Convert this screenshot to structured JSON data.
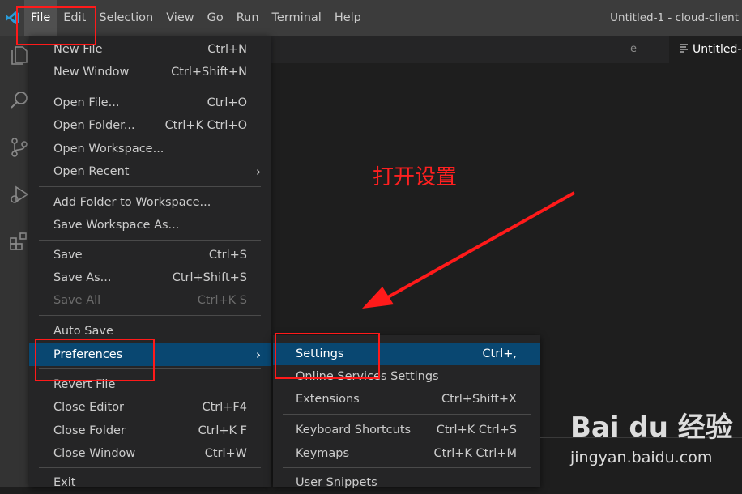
{
  "app": {
    "window_title": "Untitled-1 - cloud-client"
  },
  "menubar": {
    "items": [
      "File",
      "Edit",
      "Selection",
      "View",
      "Go",
      "Run",
      "Terminal",
      "Help"
    ]
  },
  "editor": {
    "active_tab": "Untitled-1",
    "ghost_tab_fragment": "e"
  },
  "file_menu": {
    "items": [
      {
        "label": "New File",
        "shortcut": "Ctrl+N"
      },
      {
        "label": "New Window",
        "shortcut": "Ctrl+Shift+N"
      },
      {
        "label": "Open File...",
        "shortcut": "Ctrl+O"
      },
      {
        "label": "Open Folder...",
        "shortcut": "Ctrl+K Ctrl+O"
      },
      {
        "label": "Open Workspace...",
        "shortcut": ""
      },
      {
        "label": "Open Recent",
        "shortcut": ""
      },
      {
        "label": "Add Folder to Workspace...",
        "shortcut": ""
      },
      {
        "label": "Save Workspace As...",
        "shortcut": ""
      },
      {
        "label": "Save",
        "shortcut": "Ctrl+S"
      },
      {
        "label": "Save As...",
        "shortcut": "Ctrl+Shift+S"
      },
      {
        "label": "Save All",
        "shortcut": "Ctrl+K S"
      },
      {
        "label": "Auto Save",
        "shortcut": ""
      },
      {
        "label": "Preferences",
        "shortcut": ""
      },
      {
        "label": "Revert File",
        "shortcut": ""
      },
      {
        "label": "Close Editor",
        "shortcut": "Ctrl+F4"
      },
      {
        "label": "Close Folder",
        "shortcut": "Ctrl+K F"
      },
      {
        "label": "Close Window",
        "shortcut": "Ctrl+W"
      },
      {
        "label": "Exit",
        "shortcut": ""
      }
    ]
  },
  "preferences_submenu": {
    "items": [
      {
        "label": "Settings",
        "shortcut": "Ctrl+,"
      },
      {
        "label": "Online Services Settings",
        "shortcut": ""
      },
      {
        "label": "Extensions",
        "shortcut": "Ctrl+Shift+X"
      },
      {
        "label": "Keyboard Shortcuts",
        "shortcut": "Ctrl+K Ctrl+S"
      },
      {
        "label": "Keymaps",
        "shortcut": "Ctrl+K Ctrl+M"
      },
      {
        "label": "User Snippets",
        "shortcut": ""
      }
    ]
  },
  "annotation": {
    "text": "打开设置"
  },
  "watermark": {
    "brand": "Bai du 经验",
    "url": "jingyan.baidu.com"
  },
  "colors": {
    "menu_bg": "#252526",
    "highlight": "#094771",
    "annotation_red": "#ff1a1a"
  }
}
